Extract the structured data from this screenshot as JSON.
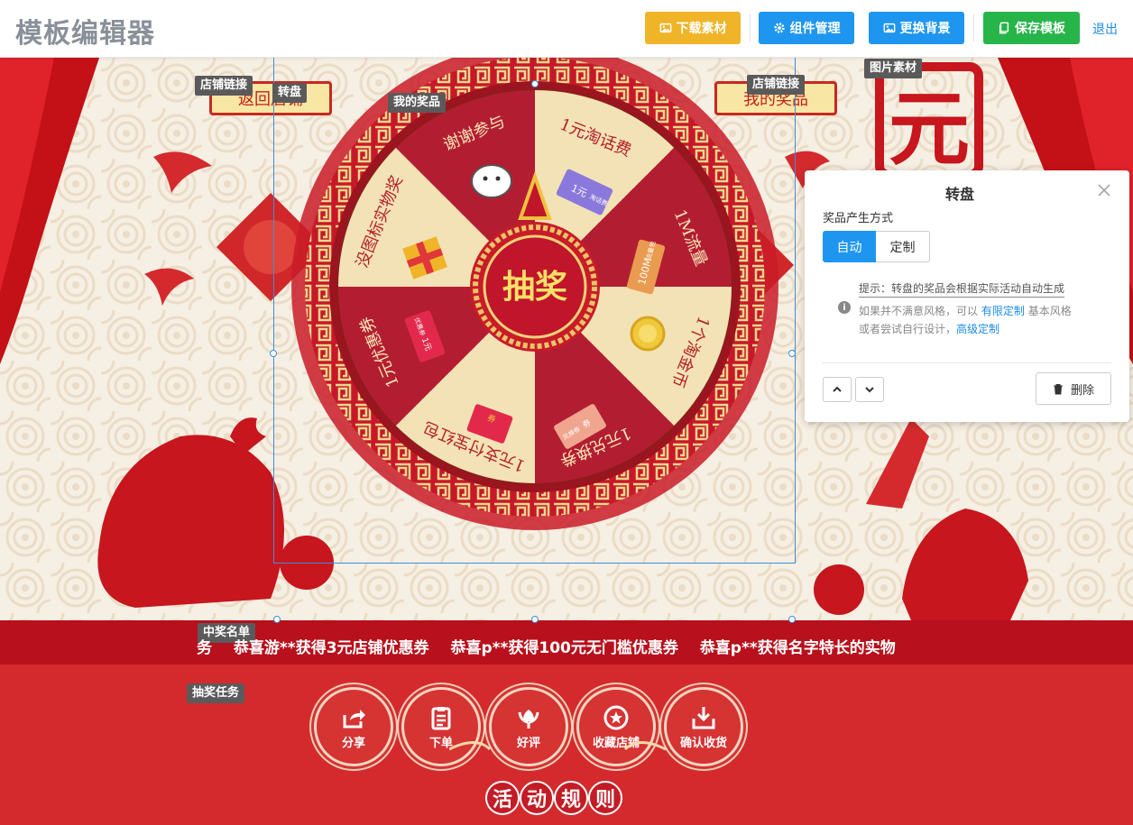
{
  "app": {
    "title": "模板编辑器"
  },
  "toolbar": {
    "download_label": "下载素材",
    "components_label": "组件管理",
    "background_label": "更换背景",
    "save_label": "保存模板",
    "exit_label": "退出",
    "download_icon": "image-icon",
    "components_icon": "gear-icon",
    "background_icon": "picture-icon",
    "save_icon": "copy-icon"
  },
  "tags": {
    "store_link_left": "店铺链接",
    "wheel": "转盘",
    "my_prizes": "我的奖品",
    "store_link_right": "店铺链接",
    "image_asset": "图片素材",
    "winner_list": "中奖名单",
    "lottery_tasks": "抽奖任务"
  },
  "signs": {
    "back_store": "返回店铺",
    "my_prizes": "我的奖品"
  },
  "wheel": {
    "center_label": "抽奖",
    "segments": [
      "1元淘话费",
      "1M流量",
      "1个淘金币",
      "1元兑换券",
      "1元支付宝红包",
      "1元优惠券",
      "没图标实物奖",
      "谢谢参与"
    ],
    "segment_colors": [
      "#f3e2b6",
      "#b31d32"
    ],
    "ticket_labels": {
      "phone_credit": "1元",
      "phone_credit_side": "淘话费",
      "data": "100M",
      "data_side": "流量包",
      "coupon_top": "优惠券",
      "coupon": "1元",
      "voucher": "兑换券",
      "voucher_mark": "券",
      "redpacket_mark": "券"
    }
  },
  "marquee": {
    "items": [
      "务",
      "恭喜游**获得3元店铺优惠券",
      "恭喜p**获得100元无门槛优惠券",
      "恭喜p**获得名字特长的实物"
    ]
  },
  "tasks": [
    {
      "label": "分享",
      "icon": "share-icon"
    },
    {
      "label": "下单",
      "icon": "clipboard-icon"
    },
    {
      "label": "好评",
      "icon": "flower-icon"
    },
    {
      "label": "收藏店铺",
      "icon": "star-icon"
    },
    {
      "label": "确认收货",
      "icon": "inbox-download-icon"
    }
  ],
  "rules": [
    "活",
    "动",
    "规",
    "则"
  ],
  "panel": {
    "title": "转盘",
    "prize_mode_label": "奖品产生方式",
    "mode_auto": "自动",
    "mode_custom": "定制",
    "hint_title": "提示：转盘的奖品会根据实际活动自动生成",
    "hint_line1_prefix": "如果并不满意风格，可以",
    "hint_link_limited": "有限定制",
    "hint_line1_suffix": "基本风格",
    "hint_line2_prefix": "或者尝试自行设计，",
    "hint_link_advanced": "高级定制",
    "delete_label": "删除"
  },
  "colors": {
    "primary": "#1e96f0",
    "warning": "#f0b429",
    "success": "#27b54a",
    "festive_red": "#c41c25"
  }
}
